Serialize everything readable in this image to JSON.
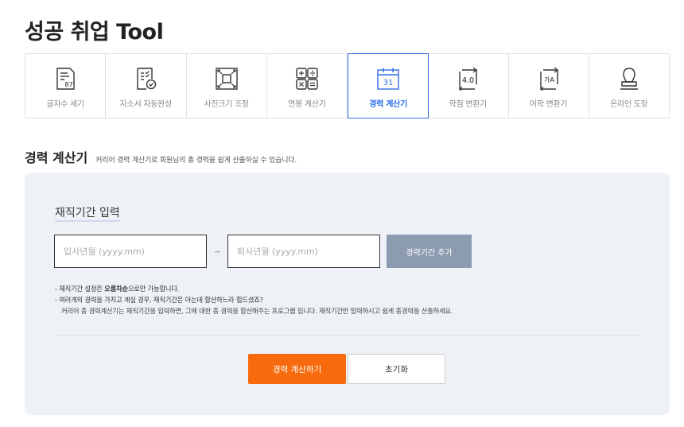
{
  "page": {
    "title": "성공 취업 Tool"
  },
  "tools": [
    {
      "label": "글자수 세기",
      "icon": "document-count-icon",
      "icon_text": "87"
    },
    {
      "label": "자소서 자동완성",
      "icon": "document-check-icon"
    },
    {
      "label": "사진크기 조정",
      "icon": "resize-icon"
    },
    {
      "label": "연봉 계산기",
      "icon": "calculator-icon"
    },
    {
      "label": "경력 계산기",
      "icon": "calendar-icon",
      "icon_text": "31",
      "active": true
    },
    {
      "label": "학점 변환기",
      "icon": "grade-convert-icon",
      "icon_text": "4.0"
    },
    {
      "label": "어학 변환기",
      "icon": "language-convert-icon",
      "icon_text": "가A"
    },
    {
      "label": "온라인 도장",
      "icon": "stamp-icon"
    }
  ],
  "section": {
    "title": "경력 계산기",
    "description": "커리어 경력 계산기로 회원님의 총 경력을 쉽게 산출하실 수 있습니다."
  },
  "form": {
    "title": "재직기간 입력",
    "start_placeholder": "입사년월 (yyyy.mm)",
    "end_placeholder": "퇴사년월 (yyyy.mm)",
    "separator": "~",
    "add_button": "경력기간 추가"
  },
  "notes": {
    "line1_prefix": "- 재직기간 설정은 ",
    "line1_bold": "오름차순",
    "line1_suffix": "으로만 가능합니다.",
    "line2": "- 여러개의 경력을 가지고 계실 경우, 재직기간은 아는데 합산하느라 힘드셨죠?",
    "line3": "커리어 총 경력계산기는 재직기간을 입력하면, 그에 대한 총 경력을 합산해주는 프로그램 입니다. 재직기간만 입력하시고 쉽게 총경력을 산출하세요."
  },
  "actions": {
    "calculate": "경력 계산하기",
    "reset": "초기화"
  },
  "colors": {
    "accent": "#2f6ee8",
    "primary_button": "#f76a0d",
    "add_button": "#8d9bb0",
    "panel_bg": "#eef1f5"
  }
}
